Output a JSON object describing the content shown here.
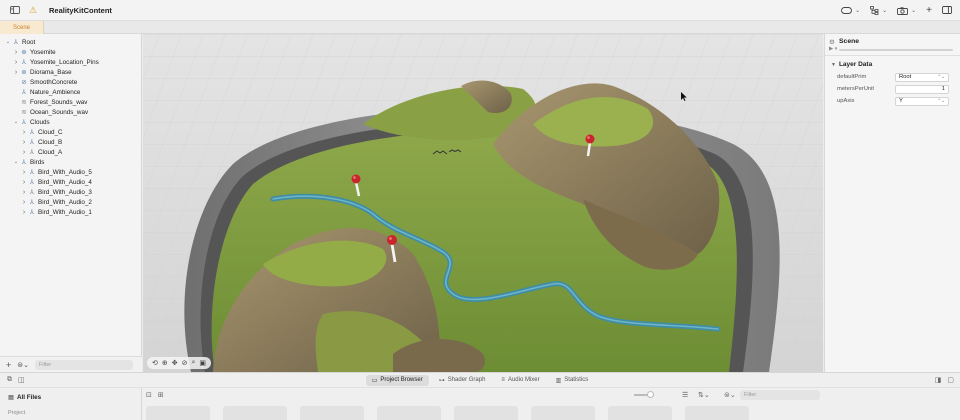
{
  "window": {
    "title": "RealityKitContent",
    "warning_icon": "warning-triangle-icon"
  },
  "tabs": {
    "active_label": "Scene"
  },
  "hierarchy": {
    "items": [
      {
        "label": "Root",
        "indent": 0,
        "disclosure": "open",
        "icon": "transform-icon"
      },
      {
        "label": "Yosemite",
        "indent": 1,
        "disclosure": "closed",
        "icon": "model-icon"
      },
      {
        "label": "Yosemite_Location_Pins",
        "indent": 1,
        "disclosure": "closed",
        "icon": "transform-icon"
      },
      {
        "label": "Diorama_Base",
        "indent": 1,
        "disclosure": "closed",
        "icon": "model-icon"
      },
      {
        "label": "SmoothConcrete",
        "indent": 1,
        "disclosure": "none",
        "icon": "material-icon"
      },
      {
        "label": "Nature_Ambience",
        "indent": 1,
        "disclosure": "none",
        "icon": "transform-icon"
      },
      {
        "label": "Forest_Sounds_wav",
        "indent": 1,
        "disclosure": "none",
        "icon": "audio-icon"
      },
      {
        "label": "Ocean_Sounds_wav",
        "indent": 1,
        "disclosure": "none",
        "icon": "audio-icon"
      },
      {
        "label": "Clouds",
        "indent": 1,
        "disclosure": "open",
        "icon": "transform-icon"
      },
      {
        "label": "Cloud_C",
        "indent": 2,
        "disclosure": "closed",
        "icon": "transform-icon"
      },
      {
        "label": "Cloud_B",
        "indent": 2,
        "disclosure": "closed",
        "icon": "transform-icon"
      },
      {
        "label": "Cloud_A",
        "indent": 2,
        "disclosure": "closed",
        "icon": "transform-icon"
      },
      {
        "label": "Birds",
        "indent": 1,
        "disclosure": "open",
        "icon": "transform-icon"
      },
      {
        "label": "Bird_With_Audio_5",
        "indent": 2,
        "disclosure": "closed",
        "icon": "transform-icon"
      },
      {
        "label": "Bird_With_Audio_4",
        "indent": 2,
        "disclosure": "closed",
        "icon": "transform-icon"
      },
      {
        "label": "Bird_With_Audio_3",
        "indent": 2,
        "disclosure": "closed",
        "icon": "transform-icon"
      },
      {
        "label": "Bird_With_Audio_2",
        "indent": 2,
        "disclosure": "closed",
        "icon": "transform-icon"
      },
      {
        "label": "Bird_With_Audio_1",
        "indent": 2,
        "disclosure": "closed",
        "icon": "transform-icon"
      }
    ],
    "filter_placeholder": "Filter"
  },
  "inspector": {
    "title": "Scene",
    "section": "Layer Data",
    "props": [
      {
        "label": "defaultPrim",
        "value": "Root",
        "kind": "popup"
      },
      {
        "label": "metersPerUnit",
        "value": "1",
        "kind": "number"
      },
      {
        "label": "upAxis",
        "value": "Y",
        "kind": "popup"
      }
    ]
  },
  "bottom": {
    "tabs": [
      "Project Browser",
      "Shader Graph",
      "Audio Mixer",
      "Statistics"
    ],
    "active_tab": 0,
    "all_files": "All Files",
    "project_label": "Project",
    "filter_placeholder": "Filter"
  },
  "colors": {
    "accent": "#c6832a",
    "tab_highlight": "#f8ead0",
    "pin": "#c8262c",
    "river": "#3f8da6"
  }
}
